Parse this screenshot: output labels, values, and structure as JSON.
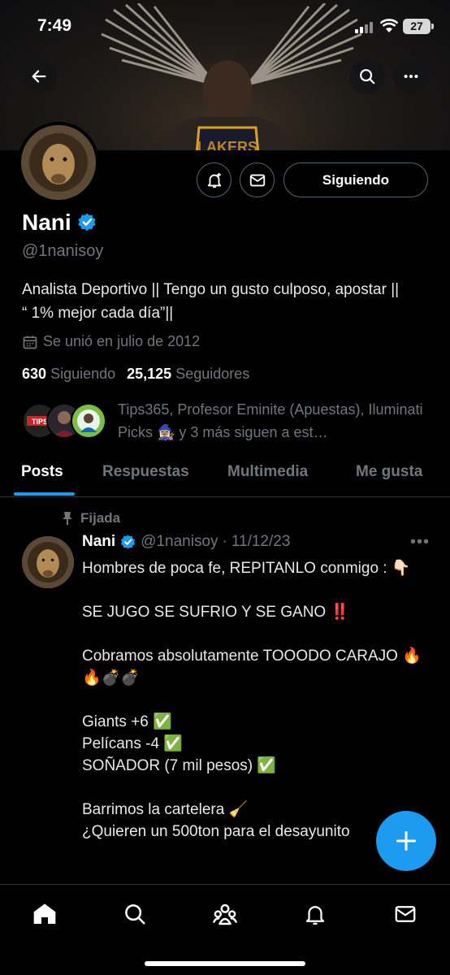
{
  "status_bar": {
    "time": "7:49",
    "battery": "27"
  },
  "header": {
    "back_icon": "arrow-left-icon",
    "search_icon": "search-icon",
    "more_icon": "more-horizontal-icon"
  },
  "banner": {
    "jersey_text": "LAKERS"
  },
  "profile": {
    "name": "Nani",
    "handle": "@1nanisoy",
    "verified_color": "#1d9bf0",
    "bio": "Analista Deportivo || Tengo un gusto culposo, apostar || “ 1% mejor cada día”||",
    "joined": "Se unió en julio de 2012",
    "following_count": "630",
    "following_label": "Siguiendo",
    "followers_count": "25,125",
    "followers_label": "Seguidores",
    "follow_button": "Siguiendo",
    "known_followers_text": "Tips365, Profesor Eminite (Apuestas), Iluminati Picks 🧙🏽‍♀️ y 3 más siguen a est…",
    "known_avatar_label": "TIPS"
  },
  "tabs": [
    {
      "label": "Posts",
      "active": true
    },
    {
      "label": "Respuestas",
      "active": false
    },
    {
      "label": "Multimedia",
      "active": false
    },
    {
      "label": "Me gusta",
      "active": false
    }
  ],
  "post": {
    "pinned_label": "Fijada",
    "name": "Nani",
    "handle": "@1nanisoy",
    "separator": "·",
    "date": "11/12/23",
    "more": "•••",
    "body": "Hombres de poca fe, REPITANLO conmigo : 👇🏻\n\nSE JUGO SE SUFRIO Y SE GANO ‼️\n\nCobramos absolutamente TOOODO CARAJO 🔥🔥💣💣\n\nGiants +6 ✅\nPelícans -4 ✅\nSOÑADOR (7 mil pesos) ✅\n\nBarrimos la cartelera 🧹\n¿Quieren un 500ton para el desayunito"
  },
  "colors": {
    "accent": "#1d9bf0",
    "muted": "#71767b",
    "border": "#536471"
  }
}
